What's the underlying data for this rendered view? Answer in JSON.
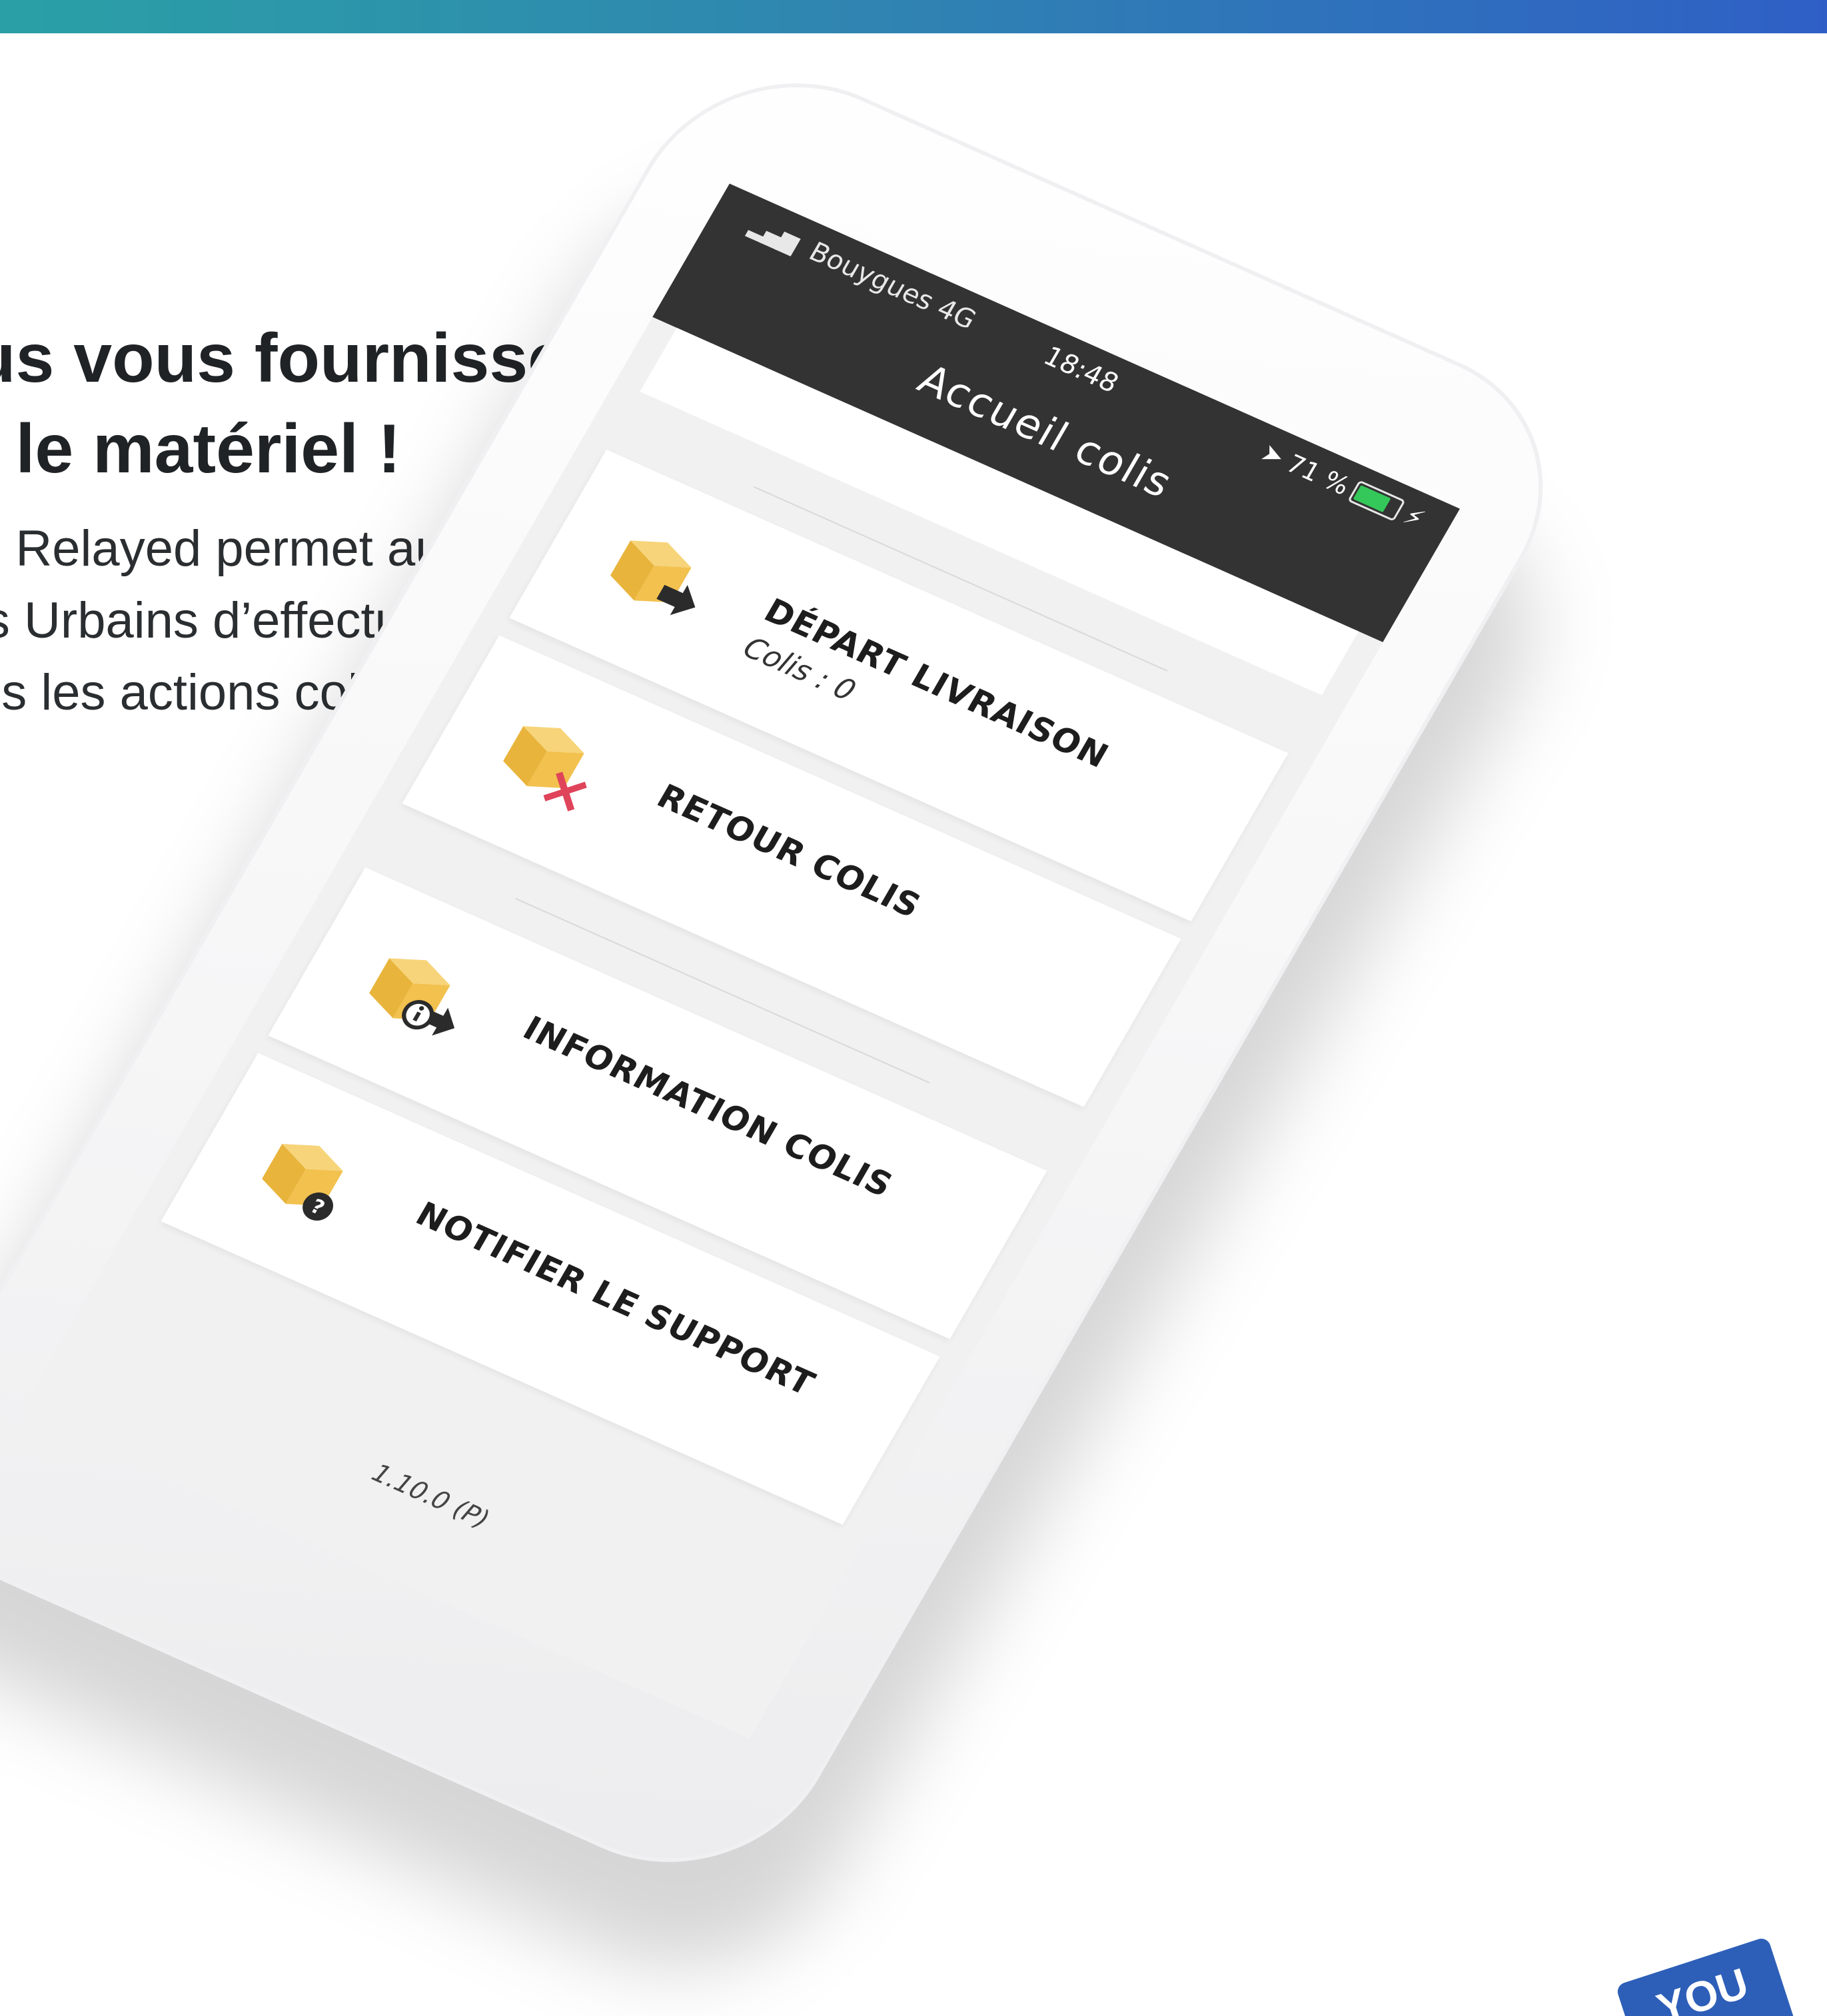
{
  "marketing": {
    "headline_line1": "us vous fournissons",
    "headline_line2": "t le matériel !",
    "body_line1": "p Relayed permet aux",
    "body_line2": "is Urbains d’effectuer",
    "body_line3": "es les actions colis !"
  },
  "phone": {
    "status_bar": {
      "carrier": "Bouygues  4G",
      "time": "18:48",
      "battery": "71 %",
      "signal_icon": "signal-bars-icon",
      "location_icon": "location-arrow-icon",
      "battery_icon": "battery-icon",
      "charging_icon": "charging-bolt-icon"
    },
    "title": "Accueil colis",
    "menu": [
      {
        "label": "DÉPART LIVRAISON",
        "sub": "Colis : 0",
        "icon": "package-arrow-icon"
      },
      {
        "label": "RETOUR COLIS",
        "sub": "",
        "icon": "package-cross-icon"
      },
      {
        "label": "INFORMATION COLIS",
        "sub": "",
        "icon": "package-info-icon"
      },
      {
        "label": "NOTIFIER LE SUPPORT",
        "sub": "",
        "icon": "package-help-icon"
      }
    ],
    "version": "1.10.0 (P)"
  },
  "logo": {
    "text": "YOU"
  },
  "colors": {
    "top_bar_start": "#2aa0a6",
    "top_bar_end": "#2f5fc6",
    "status_bar": "#333333",
    "package": "#f2c14e",
    "cross": "#e0445a",
    "battery": "#34c759",
    "logo": "#2d5fb8"
  }
}
